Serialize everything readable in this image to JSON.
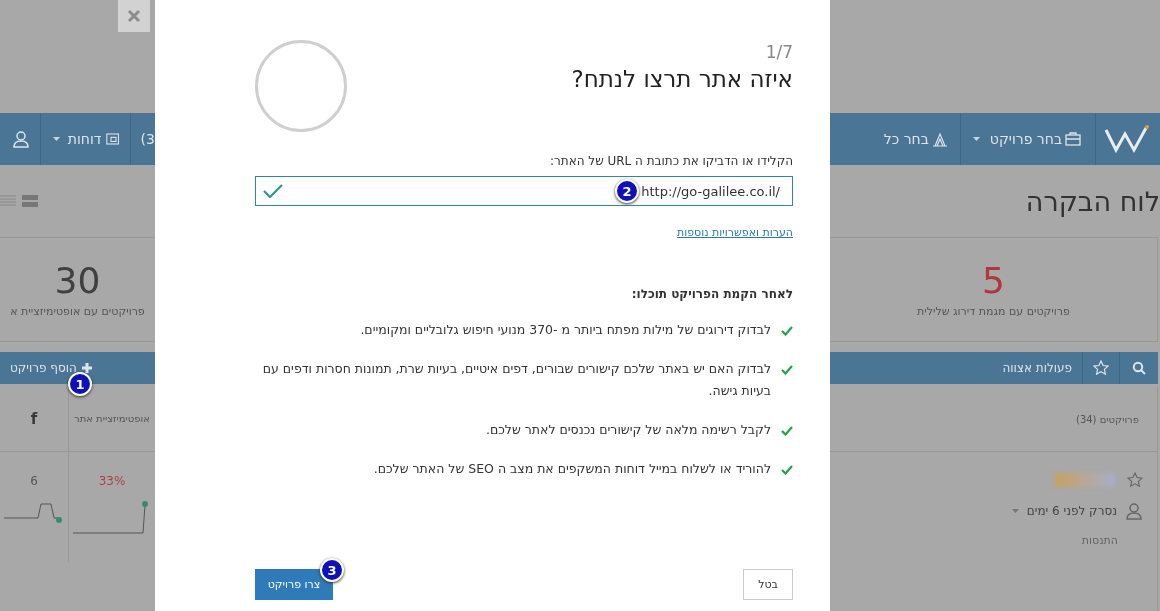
{
  "background_page": {
    "top_nav": {
      "reports": "דוחות",
      "count_partial": "(3",
      "select_all_partial": "בחר כל",
      "select_project": "בחר פרויקט"
    },
    "page_title": "לוח הבקרה",
    "stats": [
      {
        "value": "5",
        "label": "פרויקטים עם מגמת דירוג שלילית",
        "negative": true
      },
      {
        "value": "30",
        "label": "פרויקטים עם אופטימיזציית א",
        "negative": false
      }
    ],
    "action_bar": {
      "batch_actions": "פעולות אצווה",
      "add_project": "הוסף פרויקט",
      "add_project_badge": "1"
    },
    "table": {
      "columns": [
        "פרויקטים (34)",
        "אופטימיזציית אתר",
        "f"
      ],
      "rows": [
        {
          "scanned": "נסרק לפני 6 ימים",
          "tag": "התנסות",
          "site_optimization": "33%",
          "facebook": "6"
        }
      ]
    }
  },
  "modal": {
    "step": "1/7",
    "title": "איזה אתר תרצו לנתח?",
    "url_label": "הקלידו או הדביקו את כתובת ה URL של האתר:",
    "url_value": "http://go-galilee.co.il/",
    "url_valid": true,
    "url_badge": "2",
    "more_options_link": "הערות ואפשרויות נוספות",
    "benefits_heading": "לאחר הקמת הפרויקט תוכלו:",
    "benefits": [
      "לבדוק דירוגים של מילות מפתח ביותר מ -370 מנועי חיפוש גלובליים ומקומיים.",
      "לבדוק האם יש באתר שלכם קישורים שבורים, דפים איטיים, בעיות שרת, תמונות חסרות ודפים עם בעיות גישה.",
      "לקבל רשימה מלאה של קישורים נכנסים לאתר שלכם.",
      "להוריד או לשלוח במייל דוחות המשקפים את מצב ה SEO של האתר שלכם."
    ],
    "cancel_button": "בטל",
    "create_button": "צרו פרויקט",
    "create_badge": "3"
  }
}
